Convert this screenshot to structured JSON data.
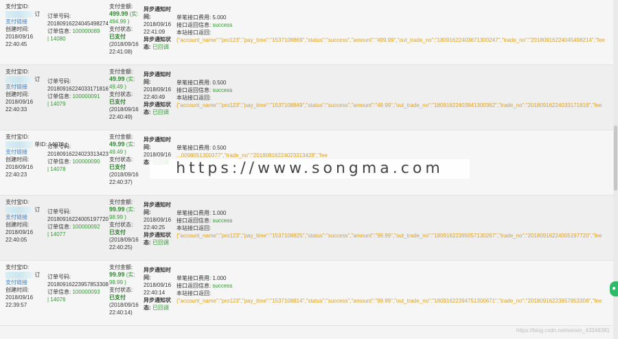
{
  "rows": [
    {
      "alipay_id_label": "支付宝ID:",
      "order_suffix": "订",
      "link": "支付链接",
      "created_label": "创建时间:",
      "date": "2018/09/16",
      "time": "22:40:45",
      "order_no_label": "订单号码:",
      "order_no": "20180916224045498274",
      "order_info_label": "订单信息:",
      "order_info_value": "100000089",
      "order_id": "| 14080",
      "pay_amount_label": "支付金额:",
      "pay_amount": "499.99",
      "actual": "(实:",
      "actual_val": "494.99 )",
      "pay_status_label": "支付状态:",
      "pay_status": "已支付",
      "pay_time": "(2018/09/16",
      "pay_time2": "22:41:08)",
      "notify_label": "异步通知时",
      "notify_label2": "间:",
      "notify_date": "2018/09/16",
      "notify_time": "22:41:09",
      "notify_status_label": "异步通知状",
      "notify_status_label2": "态:",
      "notify_status": "已回调",
      "fee_label": "单笔接口费用:",
      "fee": "5.000",
      "return_label": "接口返回信息:",
      "return_val": "success",
      "local_label": "本站接口返回:",
      "json": "{\"account_name\":\"pro123\",\"pay_time\":\"1537108869\",\"status\":\"success\",\"amount\":\"499.99\",\"out_trade_no\":\"18091622403671300247\",\"trade_no\":\"20180916224045498214\",\"fee"
    },
    {
      "alipay_id_label": "支付宝ID:",
      "order_suffix": "订",
      "link": "支付链接",
      "created_label": "创建时间:",
      "date": "2018/09/16",
      "time": "22:40:33",
      "order_no_label": "订单号码:",
      "order_no": "20180916224033171816",
      "order_info_label": "订单信息:",
      "order_info_value": "100000091",
      "order_id": "| 14079",
      "pay_amount_label": "支付金额:",
      "pay_amount": "49.99",
      "actual": "(实:",
      "actual_val": "49.49 )",
      "pay_status_label": "支付状态:",
      "pay_status": "已支付",
      "pay_time": "(2018/09/16",
      "pay_time2": "22:40:49)",
      "notify_label": "异步通知时",
      "notify_label2": "间:",
      "notify_date": "2018/09/16",
      "notify_time": "22:40:49",
      "notify_status_label": "异步通知状",
      "notify_status_label2": "态:",
      "notify_status": "已回调",
      "fee_label": "单笔接口费用:",
      "fee": "0.500",
      "return_label": "接口返回信息:",
      "return_val": "success",
      "local_label": "本站接口返回:",
      "json": "{\"account_name\":\"pro123\",\"pay_time\":\"1537108849\",\"status\":\"success\",\"amount\":\"49.99\",\"out_trade_no\":\"18091622403941300362\",\"trade_no\":\"20180916224033171818\",\"fee"
    },
    {
      "alipay_id_label": "支付宝ID:",
      "order_suffix": "单ID: 14078 (",
      "link": "支付链接",
      "created_label": "创建时间:",
      "date": "2018/09/16",
      "time": "22:40:23",
      "order_no_label": "订单号码:",
      "order_no": "20180916224023313423",
      "order_info_label": "订单信息:",
      "order_info_value": "100000090",
      "order_id": "| 14078",
      "pay_amount_label": "支付金额:",
      "pay_amount": "49.99",
      "actual": "(实:",
      "actual_val": "49.49 )",
      "pay_status_label": "支付状态:",
      "pay_status": "已支付",
      "pay_time": "(2018/09/16",
      "pay_time2": "22:40:37)",
      "notify_label": "异步通知时",
      "notify_label2": "间:",
      "notify_date": "2018/09/16",
      "notify_time": "",
      "notify_status_label": "",
      "notify_status_label2": "态:",
      "notify_status": "已回调",
      "fee_label": "单笔接口费用:",
      "fee": "0.500",
      "return_label": "",
      "return_val": "",
      "local_label": "",
      "json": "...0098051300377\",\"trade_no\":\"20180916224023313428\",\"fee"
    },
    {
      "alipay_id_label": "支付宝ID:",
      "order_suffix": "订",
      "link": "支付链接",
      "created_label": "创建时间:",
      "date": "2018/09/16",
      "time": "22:40:05",
      "order_no_label": "订单号码:",
      "order_no": "20180916224005197720",
      "order_info_label": "订单信息:",
      "order_info_value": "100000092",
      "order_id": "| 14077",
      "pay_amount_label": "支付金额:",
      "pay_amount": "99.99",
      "actual": "(实:",
      "actual_val": "98.99 )",
      "pay_status_label": "支付状态:",
      "pay_status": "已支付",
      "pay_time": "(2018/09/16",
      "pay_time2": "22:40:25)",
      "notify_label": "异步通知时",
      "notify_label2": "间:",
      "notify_date": "2018/09/16",
      "notify_time": "22:40:25",
      "notify_status_label": "异步通知状",
      "notify_status_label2": "态:",
      "notify_status": "已回调",
      "fee_label": "单笔接口费用:",
      "fee": "1.000",
      "return_label": "接口返回信息:",
      "return_val": "success",
      "local_label": "本站接口返回:",
      "json": "{\"account_name\":\"pro123\",\"pay_time\":\"1537108825\",\"status\":\"success\",\"amount\":\"99.99\",\"out_trade_no\":\"18091622395057130267\",\"trade_no\":\"20180916224005197720\",\"fee"
    },
    {
      "alipay_id_label": "支付宝ID:",
      "order_suffix": "订",
      "link": "支付链接",
      "created_label": "创建时间:",
      "date": "2018/09/16",
      "time": "22:39:57",
      "order_no_label": "订单号码:",
      "order_no": "20180916223957853308",
      "order_info_label": "订单信息:",
      "order_info_value": "100000093",
      "order_id": "| 14076",
      "pay_amount_label": "支付金额:",
      "pay_amount": "99.99",
      "actual": "(实:",
      "actual_val": "98.99 )",
      "pay_status_label": "支付状态:",
      "pay_status": "已支付",
      "pay_time": "(2018/09/16",
      "pay_time2": "22:40:14)",
      "notify_label": "异步通知时",
      "notify_label2": "间:",
      "notify_date": "2018/09/16",
      "notify_time": "22:40:14",
      "notify_status_label": "异步通知状",
      "notify_status_label2": "态:",
      "notify_status": "已回调",
      "fee_label": "单笔接口费用:",
      "fee": "1.000",
      "return_label": "接口返回信息:",
      "return_val": "success",
      "local_label": "本站接口返回:",
      "json": "{\"account_name\":\"pro123\",\"pay_time\":\"1537108814\",\"status\":\"success\",\"amount\":\"99.99\",\"out_trade_no\":\"18091622394751300671\",\"trade_no\":\"20180916223957853308\",\"fee"
    }
  ],
  "watermark": "https://www.songma.com",
  "csdn_mark": "https://blog.csdn.net/weixin_43348381",
  "colors": {
    "accent_green": "#2e9a2e",
    "link_blue": "#3a7fc9",
    "json_orange": "#e0a020"
  }
}
